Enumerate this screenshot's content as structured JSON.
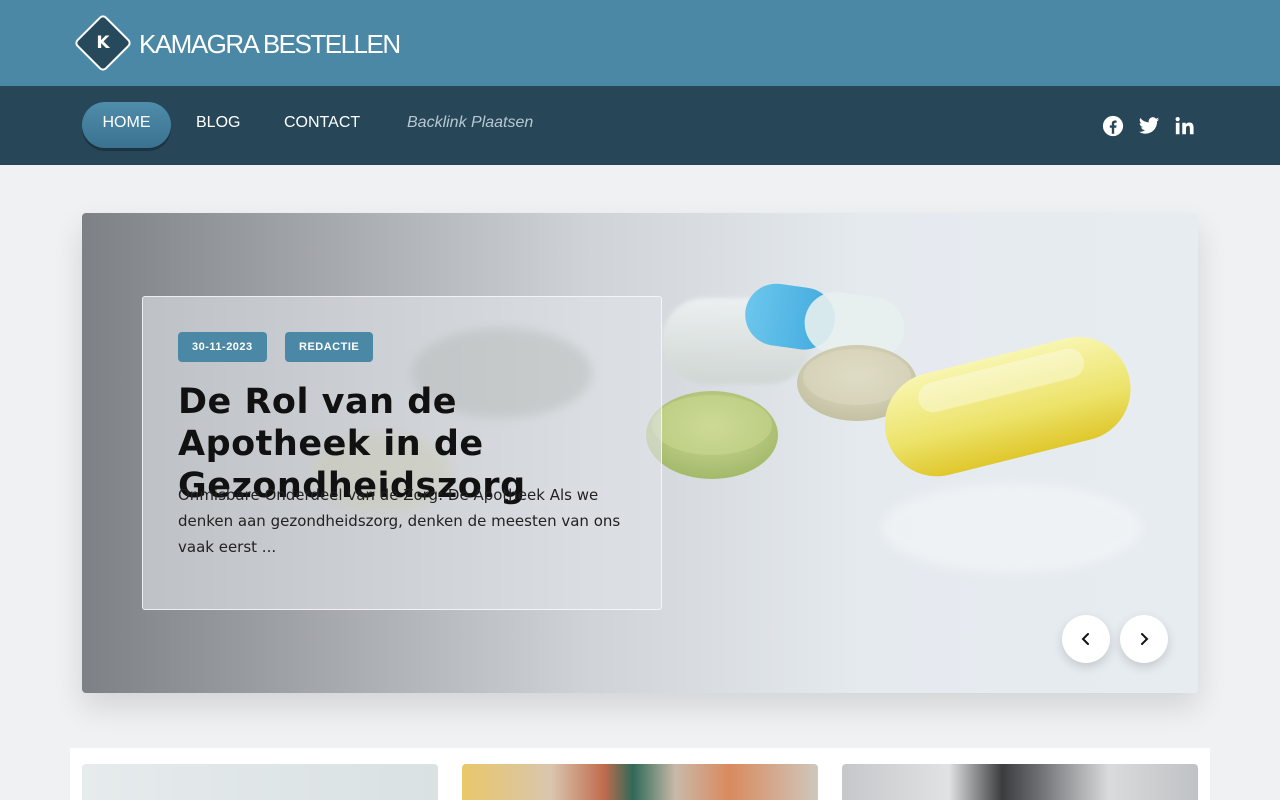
{
  "header": {
    "logo_letter": "K",
    "site_name": "KAMAGRA BESTELLEN"
  },
  "nav": {
    "items": [
      {
        "label": "HOME",
        "active": true
      },
      {
        "label": "BLOG"
      },
      {
        "label": "CONTACT"
      },
      {
        "label": "Backlink Plaatsen"
      }
    ],
    "social": [
      "facebook-icon",
      "twitter-icon",
      "linkedin-icon"
    ]
  },
  "hero": {
    "date": "30-11-2023",
    "author": "REDACTIE",
    "title": "De Rol van de Apotheek in de Gezondheidszorg",
    "excerpt": "Onmisbare Onderdeel van de Zorg: De Apotheek Als we denken aan gezondheidszorg, denken de meesten van ons vaak eerst ...",
    "prev_icon": "chevron-left-icon",
    "next_icon": "chevron-right-icon"
  },
  "colors": {
    "header_bg": "#4a88a6",
    "nav_bg": "#274657",
    "accent": "#4a88a6",
    "page_bg": "#eff1f3"
  }
}
